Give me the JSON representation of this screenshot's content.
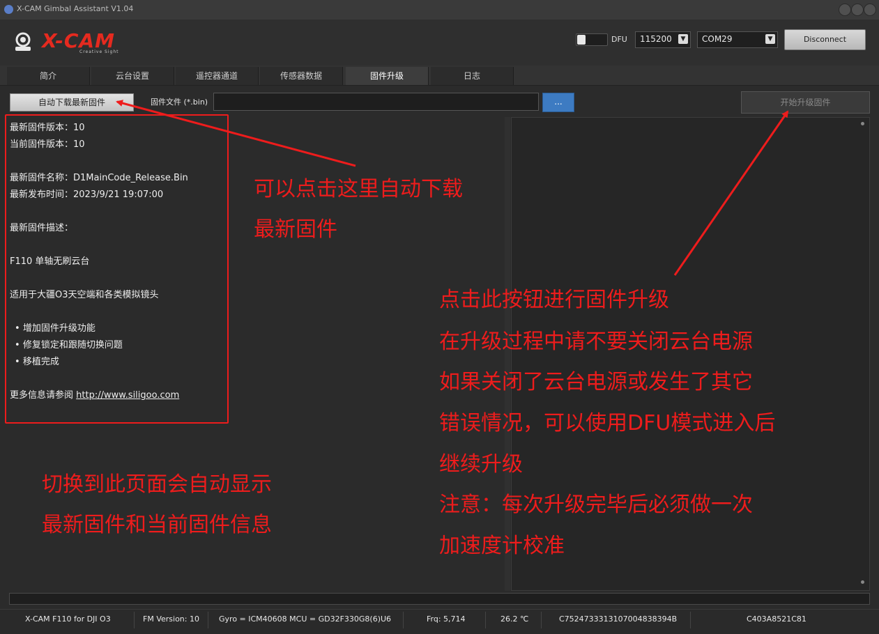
{
  "window": {
    "title": "X-CAM Gimbal Assistant V1.04"
  },
  "header": {
    "logo_text": "X-CAM",
    "logo_sub": "Creative Sight",
    "dfu_label": "DFU",
    "baud_rate": "115200",
    "port": "COM29",
    "disconnect_label": "Disconnect"
  },
  "tabs": [
    {
      "label": "简介"
    },
    {
      "label": "云台设置"
    },
    {
      "label": "遥控器通道"
    },
    {
      "label": "传感器数据"
    },
    {
      "label": "固件升级",
      "active": true
    },
    {
      "label": "日志"
    }
  ],
  "toolbar": {
    "auto_download_label": "自动下载最新固件",
    "firmware_file_label": "固件文件 (*.bin)",
    "firmware_file_value": "",
    "browse_label": "...",
    "start_upgrade_label": "开始升级固件"
  },
  "info": {
    "latest_version": "最新固件版本：10",
    "current_version": "当前固件版本：10",
    "latest_name": "最新固件名称：D1MainCode_Release.Bin",
    "release_time": "最新发布时间：2023/9/21 19:07:00",
    "desc_label": "最新固件描述：",
    "desc_line1": "F110 单轴无刷云台",
    "desc_line2": "适用于大疆O3天空端和各类模拟镜头",
    "bullets": [
      "增加固件升级功能",
      "修复锁定和跟随切换问题",
      "移植完成"
    ],
    "more_info_prefix": "更多信息请参阅 ",
    "more_info_link": "http://www.siligoo.com"
  },
  "annotations": {
    "auto_download": [
      "可以点击这里自动下载",
      "最新固件"
    ],
    "switch_page": [
      "切换到此页面会自动显示",
      "最新固件和当前固件信息"
    ],
    "upgrade": [
      "点击此按钮进行固件升级",
      "在升级过程中请不要关闭云台电源",
      "如果关闭了云台电源或发生了其它",
      "错误情况，可以使用DFU模式进入后",
      "继续升级",
      "注意：每次升级完毕后必须做一次",
      "加速度计校准"
    ],
    "color": "#ee1c1c"
  },
  "status": {
    "device": "X-CAM F110 for DJI O3",
    "fm_version": "FM Version: 10",
    "sensors": "Gyro = ICM40608  MCU = GD32F330G8(6)U6",
    "frq": "Frq: 5,714",
    "temp": "26.2 ℃",
    "id1": "C752473331310700483839​4B",
    "id2": "C403A8521C81"
  }
}
